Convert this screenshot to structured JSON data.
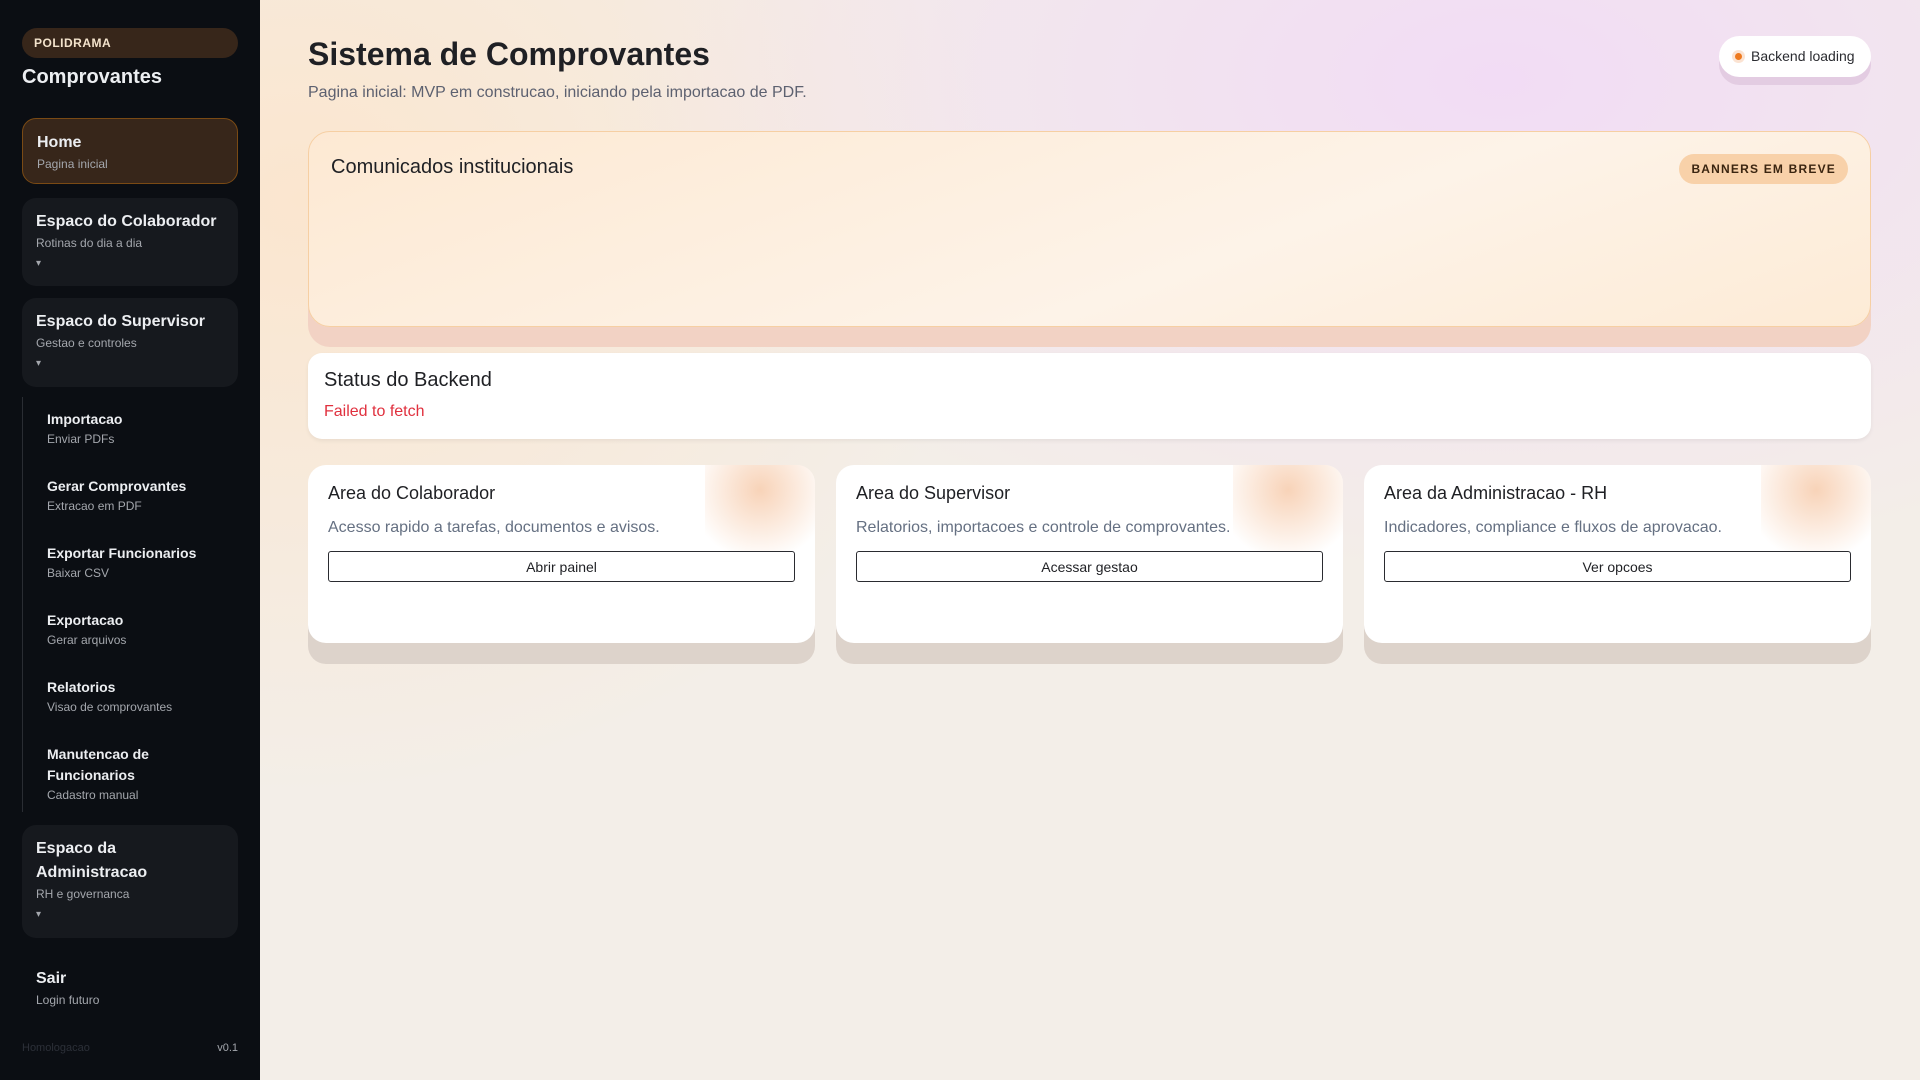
{
  "sidebar": {
    "brand": "POLIDRAMA",
    "title": "Comprovantes",
    "home": {
      "label": "Home",
      "sub": "Pagina inicial"
    },
    "colaborador": {
      "label": "Espaco do Colaborador",
      "sub": "Rotinas do dia a dia",
      "caret": "▾"
    },
    "supervisor": {
      "label": "Espaco do Supervisor",
      "sub": "Gestao e controles",
      "caret": "▾"
    },
    "supervisor_items": [
      {
        "label": "Importacao",
        "sub": "Enviar PDFs"
      },
      {
        "label": "Gerar Comprovantes",
        "sub": "Extracao em PDF"
      },
      {
        "label": "Exportar Funcionarios",
        "sub": "Baixar CSV"
      },
      {
        "label": "Exportacao",
        "sub": "Gerar arquivos"
      },
      {
        "label": "Relatorios",
        "sub": "Visao de comprovantes"
      },
      {
        "label": "Manutencao de Funcionarios",
        "sub": "Cadastro manual"
      }
    ],
    "admin": {
      "label": "Espaco da Administracao",
      "sub": "RH e governanca",
      "caret": "▾"
    },
    "sair": {
      "label": "Sair",
      "sub": "Login futuro"
    },
    "env": "Homologacao",
    "version": "v0.1"
  },
  "header": {
    "title": "Sistema de Comprovantes",
    "subtitle": "Pagina inicial: MVP em construcao, iniciando pela importacao de PDF.",
    "backend_status": "Backend loading"
  },
  "banner": {
    "title": "Comunicados institucionais",
    "tag": "BANNERS EM BREVE"
  },
  "status": {
    "title": "Status do Backend",
    "error": "Failed to fetch"
  },
  "cards": [
    {
      "title": "Area do Colaborador",
      "desc": "Acesso rapido a tarefas, documentos e avisos.",
      "button": "Abrir painel"
    },
    {
      "title": "Area do Supervisor",
      "desc": "Relatorios, importacoes e controle de comprovantes.",
      "button": "Acessar gestao"
    },
    {
      "title": "Area da Administracao - RH",
      "desc": "Indicadores, compliance e fluxos de aprovacao.",
      "button": "Ver opcoes"
    }
  ],
  "colors": {
    "accent": "#ee7a1f",
    "error": "#e0303e",
    "sidebar": "#0b0e13"
  }
}
